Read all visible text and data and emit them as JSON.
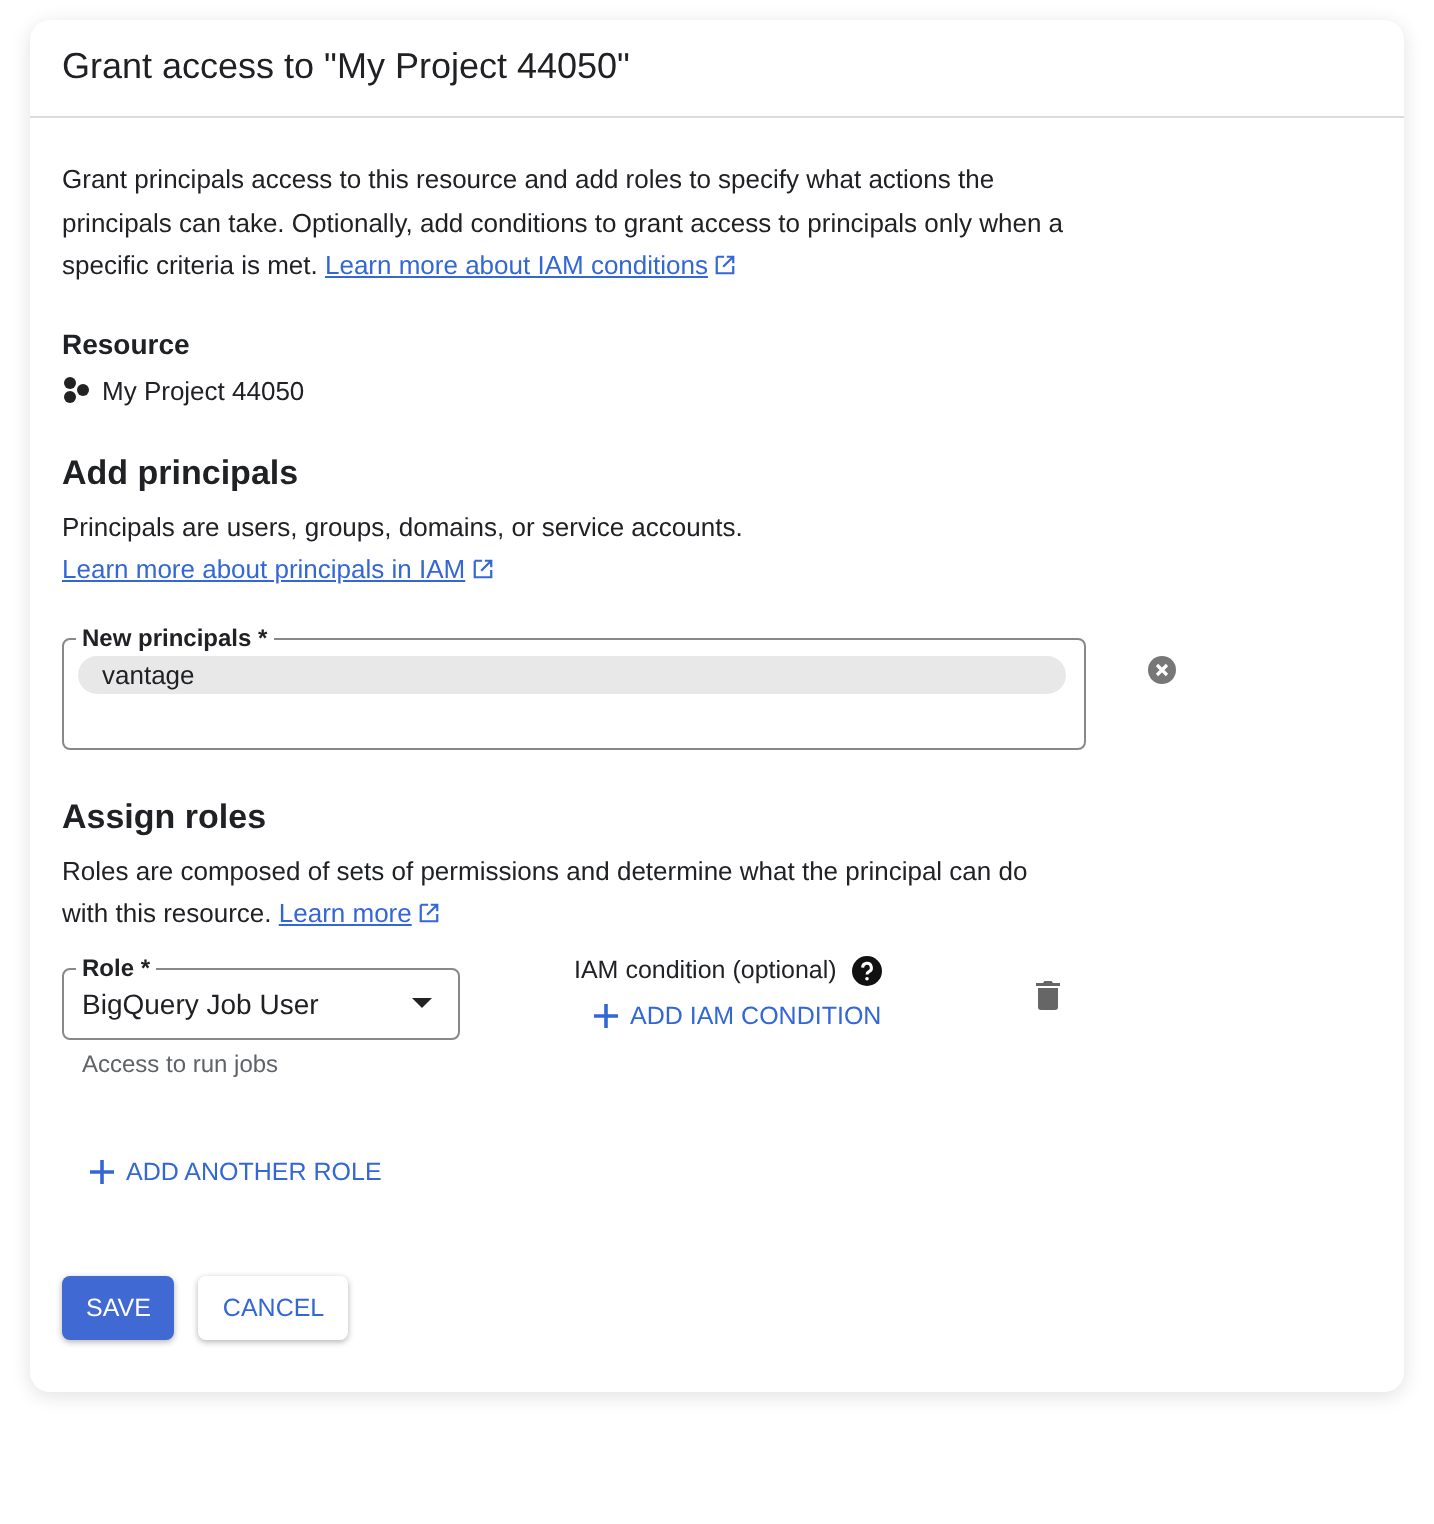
{
  "dialog": {
    "title": "Grant access to \"My Project 44050\""
  },
  "intro": {
    "text": "Grant principals access to this resource and add roles to specify what actions the principals can take. Optionally, add conditions to grant access to principals only when a specific criteria is met.",
    "link": "Learn more about IAM conditions"
  },
  "resource": {
    "heading": "Resource",
    "name": "My Project 44050"
  },
  "principals": {
    "heading": "Add principals",
    "text": "Principals are users, groups, domains, or service accounts.",
    "link": "Learn more about principals in IAM",
    "field_label": "New principals *",
    "chips": [
      "vantage"
    ]
  },
  "roles": {
    "heading": "Assign roles",
    "text": "Roles are composed of sets of permissions and determine what the principal can do with this resource.",
    "link": "Learn more",
    "role_label": "Role *",
    "role_value": "BigQuery Job User",
    "role_hint": "Access to run jobs",
    "condition_label": "IAM condition (optional)",
    "add_condition": "ADD IAM CONDITION",
    "add_role": "ADD ANOTHER ROLE"
  },
  "buttons": [
    {
      "label": "SAVE",
      "kind": "primary"
    },
    {
      "label": "CANCEL",
      "kind": "secondary"
    }
  ]
}
